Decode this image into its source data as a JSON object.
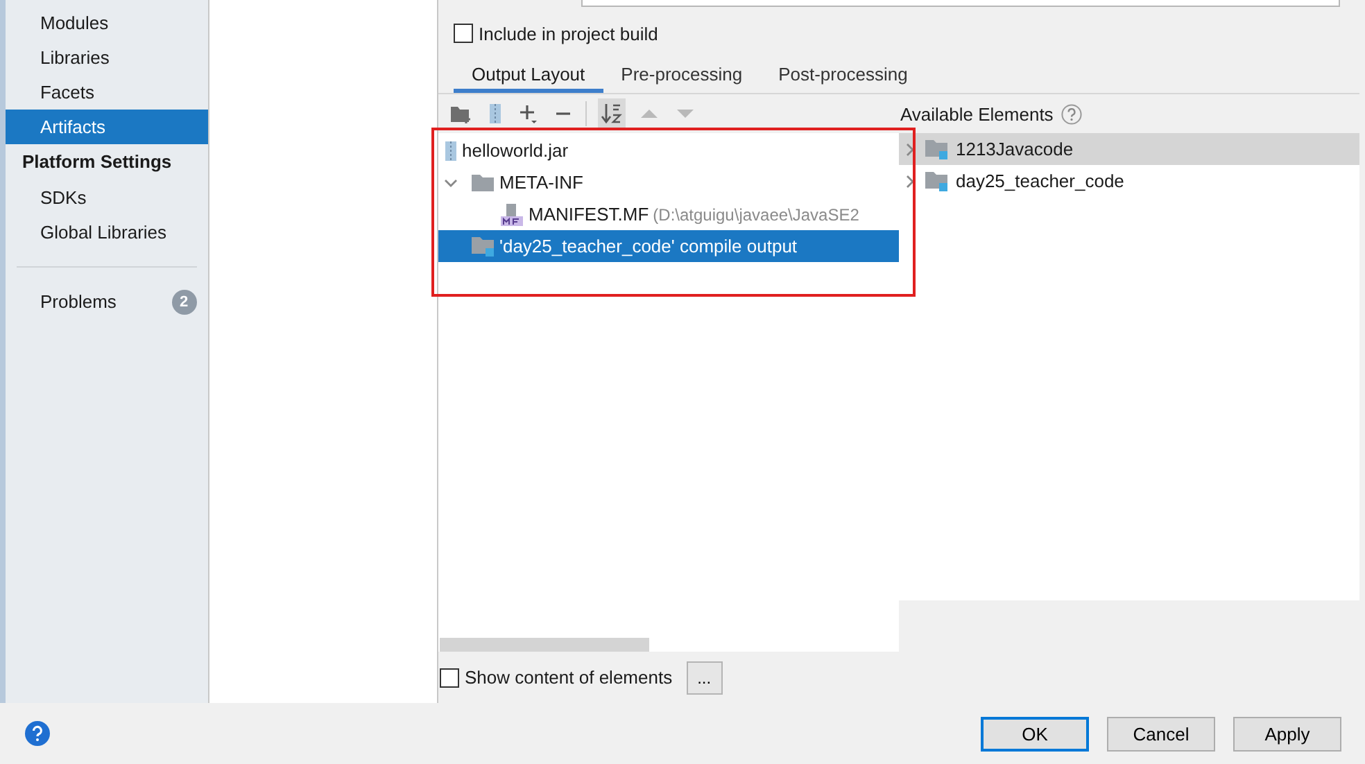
{
  "sidebar": {
    "items": [
      {
        "label": "Modules",
        "kind": "item",
        "selected": false
      },
      {
        "label": "Libraries",
        "kind": "item",
        "selected": false
      },
      {
        "label": "Facets",
        "kind": "item",
        "selected": false
      },
      {
        "label": "Artifacts",
        "kind": "item",
        "selected": true
      },
      {
        "label": "Platform Settings",
        "kind": "header"
      },
      {
        "label": "SDKs",
        "kind": "item",
        "selected": false
      },
      {
        "label": "Global Libraries",
        "kind": "item",
        "selected": false
      },
      {
        "label": "Problems",
        "kind": "problems",
        "selected": false,
        "badge": "2"
      }
    ]
  },
  "include_in_build": {
    "label": "Include in project build",
    "checked": false
  },
  "tabs": [
    {
      "label": "Output Layout",
      "selected": true
    },
    {
      "label": "Pre-processing",
      "selected": false
    },
    {
      "label": "Post-processing",
      "selected": false
    }
  ],
  "toolbar": [
    {
      "kind": "add-folder",
      "disabled": false,
      "pressed": false
    },
    {
      "kind": "archive",
      "disabled": false,
      "pressed": false
    },
    {
      "kind": "add",
      "disabled": false,
      "pressed": false
    },
    {
      "kind": "remove",
      "disabled": false,
      "pressed": false
    },
    {
      "kind": "sort",
      "disabled": false,
      "pressed": true
    },
    {
      "kind": "up",
      "disabled": true,
      "pressed": false
    },
    {
      "kind": "down",
      "disabled": true,
      "pressed": false
    }
  ],
  "layout_tree": [
    {
      "label": "helloworld.jar",
      "kind": "jar",
      "selected": false
    },
    {
      "label": "META-INF",
      "kind": "folder",
      "selected": false,
      "expanded": true,
      "children": [
        {
          "label": "MANIFEST.MF",
          "detail": "(D:\\atguigu\\javaee\\JavaSE2",
          "kind": "manifest",
          "selected": false
        }
      ]
    },
    {
      "label": "'day25_teacher_code' compile output",
      "kind": "module",
      "selected": true
    }
  ],
  "available": {
    "title": "Available Elements",
    "items": [
      {
        "label": "1213Javacode",
        "selected": true,
        "expanded": false
      },
      {
        "label": "day25_teacher_code",
        "selected": false,
        "expanded": false
      }
    ]
  },
  "show_content": {
    "label": "Show content of elements",
    "checked": false,
    "button": "..."
  },
  "buttons": [
    {
      "label": "OK",
      "default": true
    },
    {
      "label": "Cancel",
      "default": false
    },
    {
      "label": "Apply",
      "default": false
    }
  ]
}
